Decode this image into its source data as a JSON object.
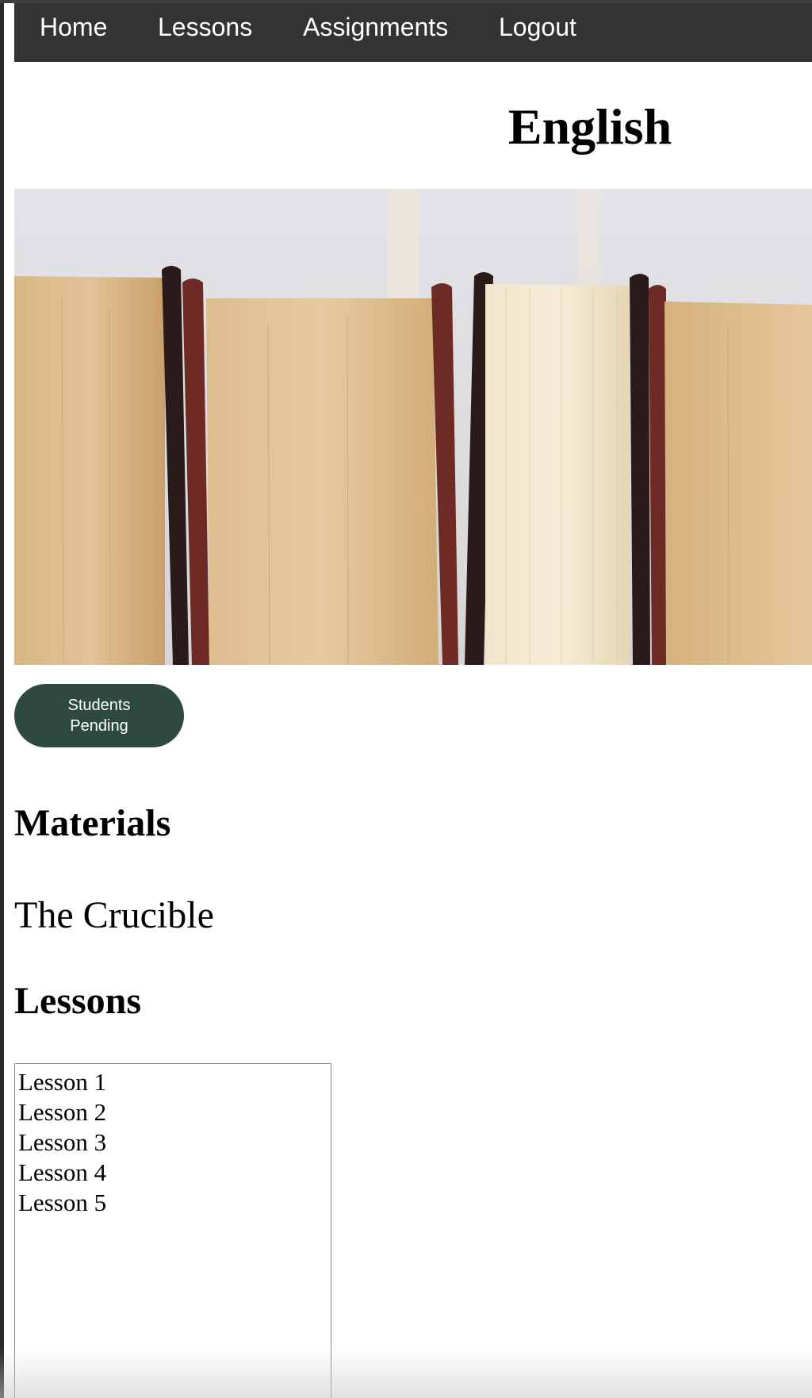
{
  "nav": {
    "items": [
      {
        "label": "Home"
      },
      {
        "label": "Lessons"
      },
      {
        "label": "Assignments"
      },
      {
        "label": "Logout"
      }
    ]
  },
  "page": {
    "title": "English"
  },
  "hero": {
    "image": "books-spines-photo"
  },
  "actions": {
    "students_pending_label": "Students Pending"
  },
  "materials": {
    "heading": "Materials",
    "items": [
      {
        "title": "The Crucible"
      }
    ]
  },
  "lessons": {
    "heading": "Lessons",
    "options": [
      "Lesson 1",
      "Lesson 2",
      "Lesson 3",
      "Lesson 4",
      "Lesson 5"
    ]
  },
  "colors": {
    "navbar_bg": "#333333",
    "button_bg": "#2e4a40",
    "button_text": "#ffffff"
  }
}
